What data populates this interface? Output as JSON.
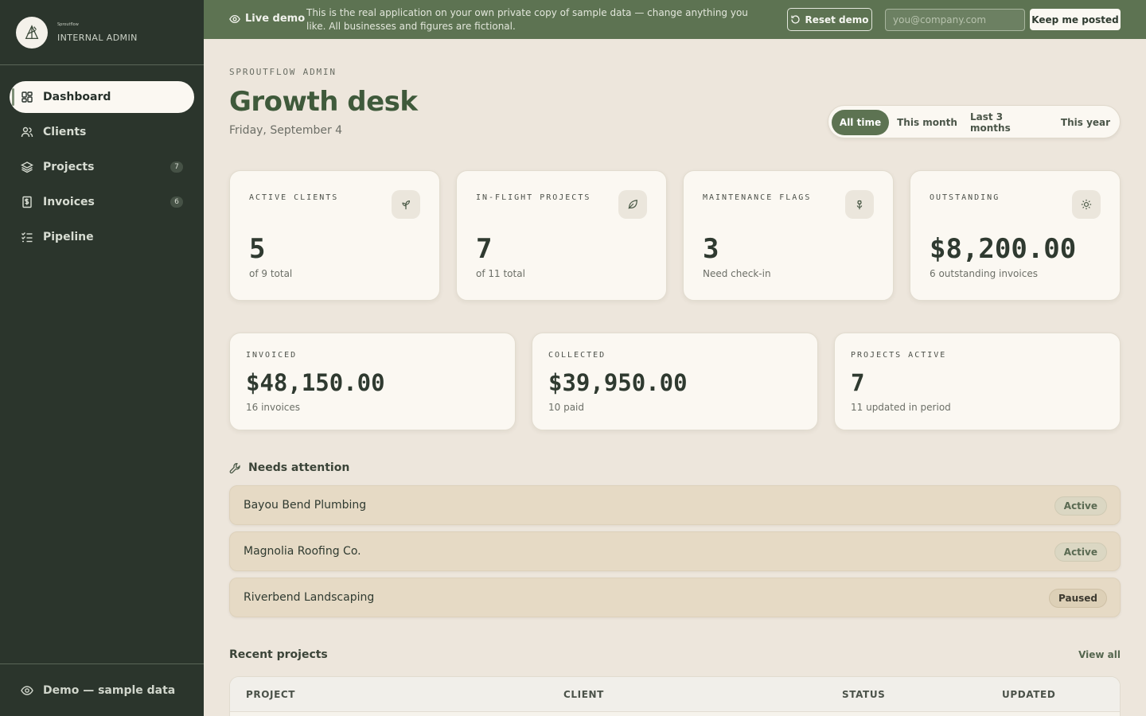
{
  "sidebar": {
    "brand_mini": "Sproutflow",
    "brand_sub": "INTERNAL ADMIN",
    "items": [
      {
        "label": "Dashboard",
        "badge": ""
      },
      {
        "label": "Clients",
        "badge": ""
      },
      {
        "label": "Projects",
        "badge": "7"
      },
      {
        "label": "Invoices",
        "badge": "6"
      },
      {
        "label": "Pipeline",
        "badge": ""
      }
    ],
    "footer": "Demo — sample data"
  },
  "banner": {
    "live": "Live demo",
    "message": "This is the real application on your own private copy of sample data — change anything you like. All businesses and figures are fictional.",
    "reset_label": "Reset demo",
    "email_placeholder": "you@company.com",
    "keep_label": "Keep me posted"
  },
  "header": {
    "eyebrow": "SPROUTFLOW ADMIN",
    "title": "Growth desk",
    "date": "Friday, September 4"
  },
  "range_tabs": [
    "All time",
    "This month",
    "Last 3 months",
    "This year"
  ],
  "stat_cards": [
    {
      "label": "ACTIVE CLIENTS",
      "value": "5",
      "sub": "of 9 total",
      "icon": "sprout-icon"
    },
    {
      "label": "IN-FLIGHT PROJECTS",
      "value": "7",
      "sub": "of 11 total",
      "icon": "leaf-icon"
    },
    {
      "label": "MAINTENANCE FLAGS",
      "value": "3",
      "sub": "Need check-in",
      "icon": "flower-icon"
    },
    {
      "label": "OUTSTANDING",
      "value": "$8,200.00",
      "sub": "6 outstanding invoices",
      "icon": "sun-icon"
    }
  ],
  "summary_cards": [
    {
      "label": "INVOICED",
      "value": "$48,150.00",
      "sub": "16 invoices"
    },
    {
      "label": "COLLECTED",
      "value": "$39,950.00",
      "sub": "10 paid"
    },
    {
      "label": "PROJECTS ACTIVE",
      "value": "7",
      "sub": "11 updated in period"
    }
  ],
  "attention": {
    "title": "Needs attention",
    "rows": [
      {
        "name": "Bayou Bend Plumbing",
        "status": "Active"
      },
      {
        "name": "Magnolia Roofing Co.",
        "status": "Active"
      },
      {
        "name": "Riverbend Landscaping",
        "status": "Paused"
      }
    ]
  },
  "recent": {
    "title": "Recent projects",
    "view_all": "View all",
    "columns": [
      "PROJECT",
      "CLIENT",
      "STATUS",
      "UPDATED"
    ]
  }
}
